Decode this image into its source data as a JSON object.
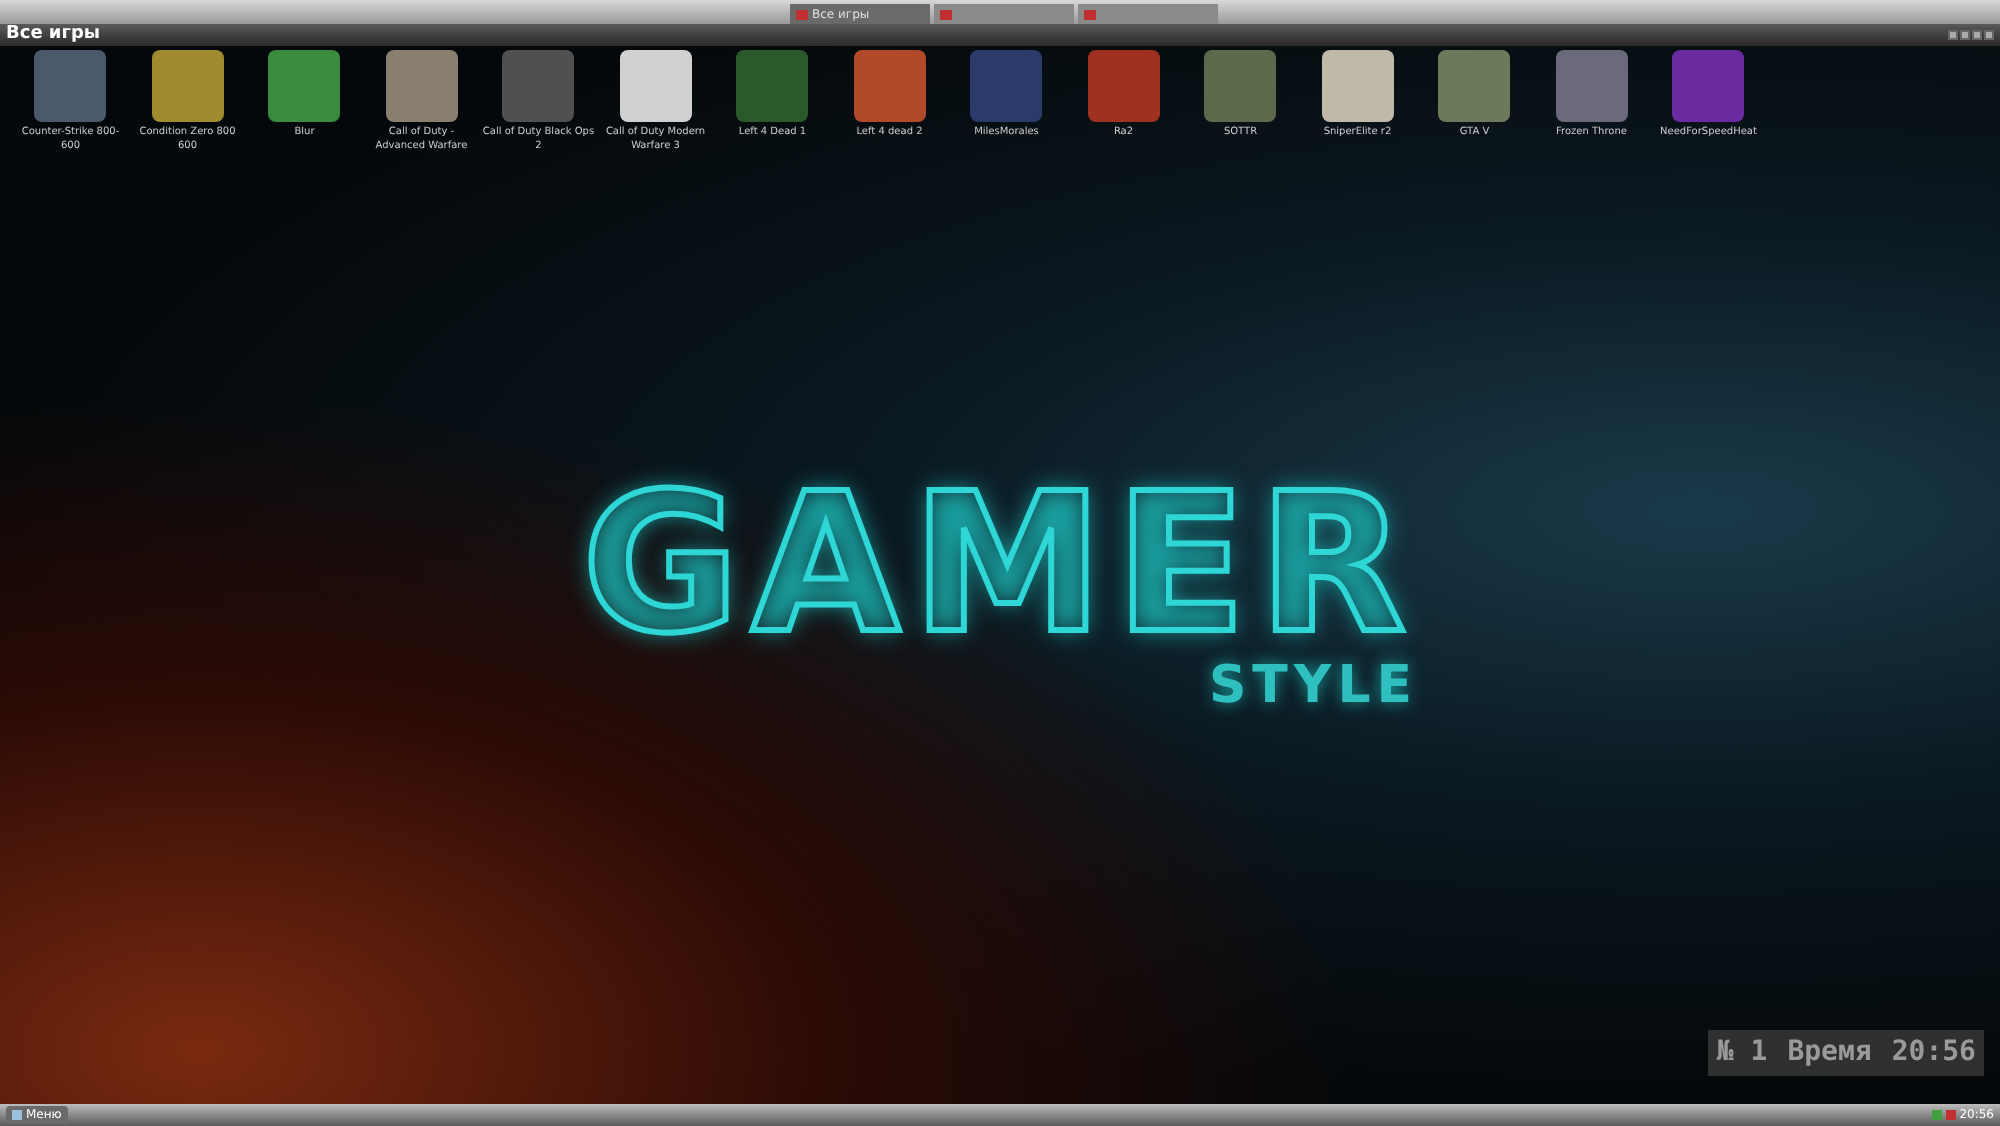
{
  "top_tabs": [
    {
      "label": "Все игры",
      "selected": true
    },
    {
      "selected": false
    },
    {
      "selected": false
    }
  ],
  "window": {
    "title": "Все игры"
  },
  "games": [
    {
      "label": "Counter-Strike 800-600",
      "color": "#4a5a6a"
    },
    {
      "label": "Condition Zero 800 600",
      "color": "#a08a30"
    },
    {
      "label": "Blur",
      "color": "#3a8a40"
    },
    {
      "label": "Call of Duty - Advanced Warfare",
      "color": "#8a8070"
    },
    {
      "label": "Call of Duty Black Ops 2",
      "color": "#505050"
    },
    {
      "label": "Call of Duty Modern Warfare 3",
      "color": "#d0d0d0"
    },
    {
      "label": "Left 4 Dead 1",
      "color": "#2a5a2a"
    },
    {
      "label": "Left 4 dead 2",
      "color": "#b04a2a"
    },
    {
      "label": "MilesMorales",
      "color": "#2a3a6a"
    },
    {
      "label": "Ra2",
      "color": "#a03020"
    },
    {
      "label": "SOTTR",
      "color": "#5a6a4a"
    },
    {
      "label": "SniperElite r2",
      "color": "#c0b8a8"
    },
    {
      "label": "GTA V",
      "color": "#6a7a5a"
    },
    {
      "label": "Frozen Throne",
      "color": "#6a6a7a"
    },
    {
      "label": "NeedForSpeedHeat",
      "color": "#6a2aa0"
    }
  ],
  "logo": {
    "title": "GAMER",
    "subtitle": "STYLE"
  },
  "overlay": {
    "number": "№ 1",
    "time_label": "Время",
    "time": "20:56"
  },
  "taskbar": {
    "start": "Меню",
    "clock": "20:56"
  }
}
